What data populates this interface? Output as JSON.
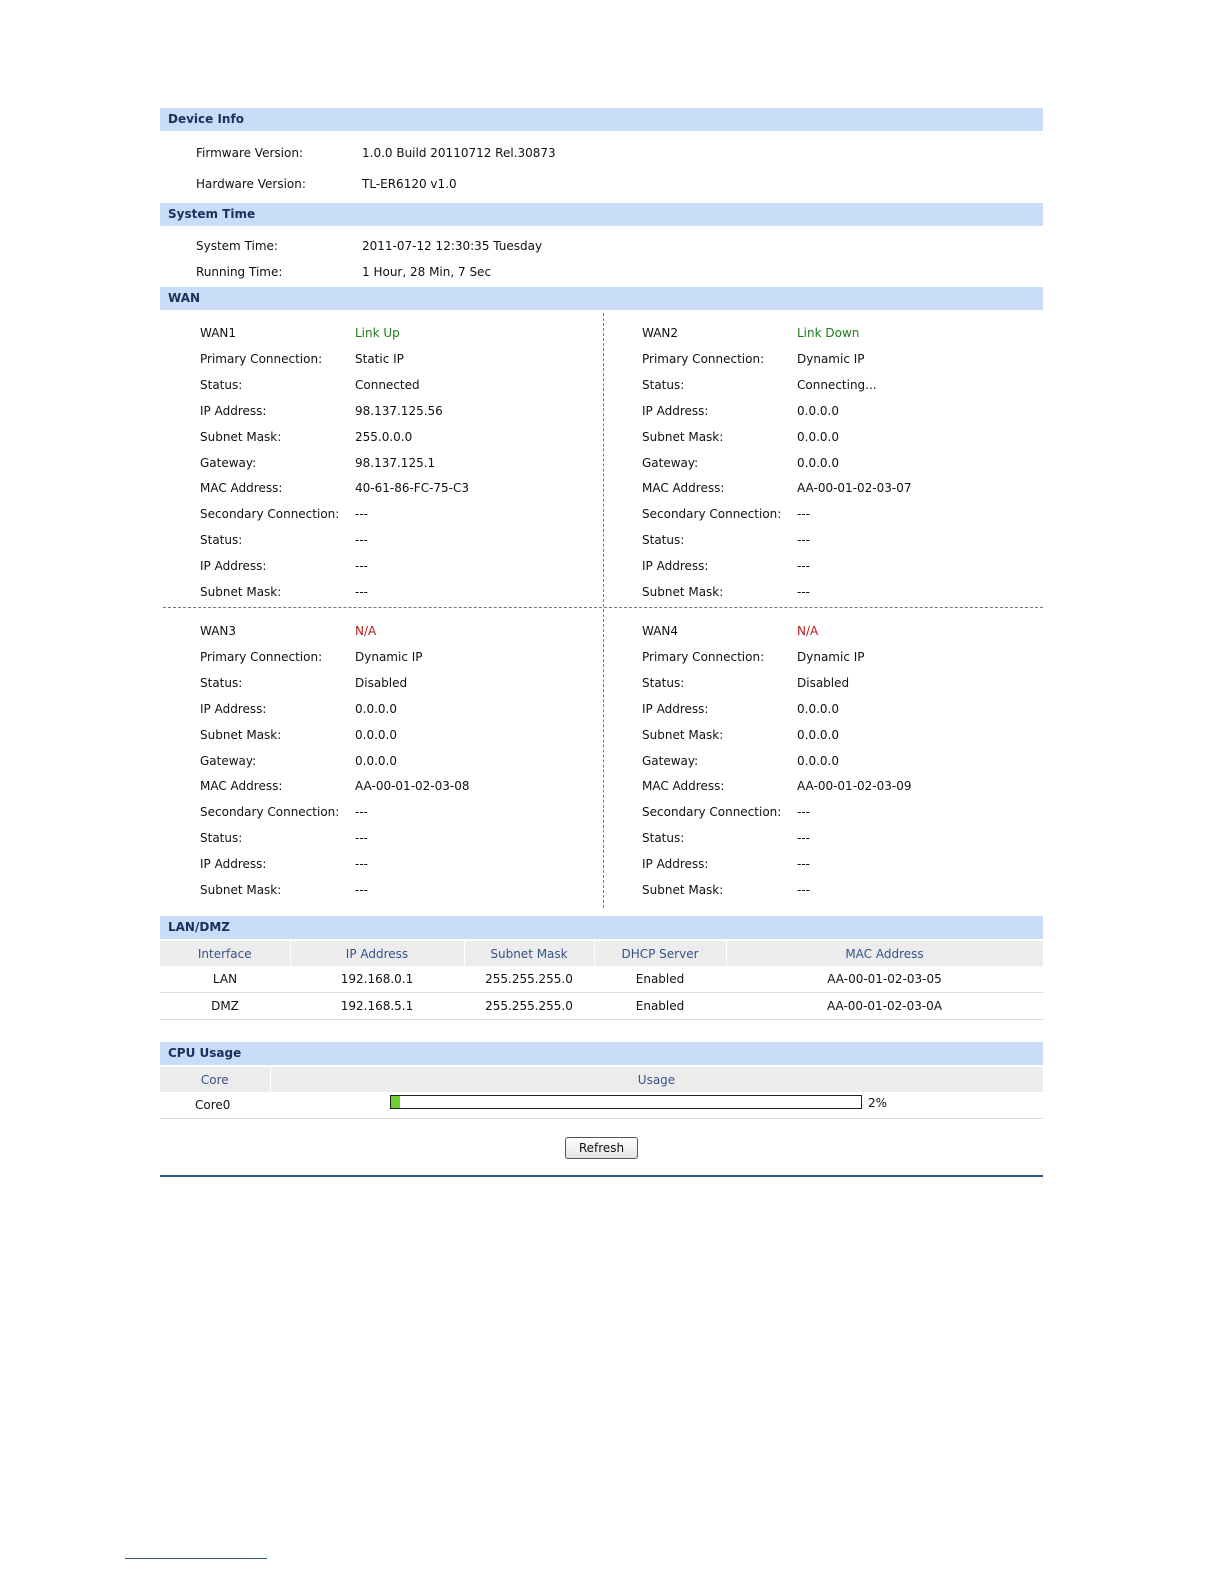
{
  "device_info": {
    "title": "Device Info",
    "firmware_label": "Firmware Version:",
    "firmware_value": "1.0.0 Build 20110712 Rel.30873",
    "hardware_label": "Hardware Version:",
    "hardware_value": "TL-ER6120 v1.0"
  },
  "system_time": {
    "title": "System Time",
    "system_time_label": "System Time:",
    "system_time_value": "2011-07-12 12:30:35 Tuesday",
    "running_time_label": "Running Time:",
    "running_time_value": "1 Hour, 28 Min, 7 Sec"
  },
  "wan": {
    "title": "WAN",
    "labels": {
      "primary": "Primary Connection:",
      "status": "Status:",
      "ip": "IP Address:",
      "mask": "Subnet Mask:",
      "gateway": "Gateway:",
      "mac": "MAC Address:",
      "secondary": "Secondary Connection:",
      "sec_status": "Status:",
      "sec_ip": "IP Address:",
      "sec_mask": "Subnet Mask:"
    },
    "ports": [
      {
        "name": "WAN1",
        "link": "Link Up",
        "link_color": "#1f7a1f",
        "primary": "Static IP",
        "status": "Connected",
        "ip": "98.137.125.56",
        "mask": "255.0.0.0",
        "gateway": "98.137.125.1",
        "mac": "40-61-86-FC-75-C3",
        "secondary": "---",
        "sec_status": "---",
        "sec_ip": "---",
        "sec_mask": "---"
      },
      {
        "name": "WAN2",
        "link": "Link Down",
        "link_color": "#1f7a1f",
        "primary": "Dynamic IP",
        "status": "Connecting...",
        "ip": "0.0.0.0",
        "mask": "0.0.0.0",
        "gateway": "0.0.0.0",
        "mac": "AA-00-01-02-03-07",
        "secondary": "---",
        "sec_status": "---",
        "sec_ip": "---",
        "sec_mask": "---"
      },
      {
        "name": "WAN3",
        "link": "N/A",
        "link_color": "#b51a1a",
        "primary": "Dynamic IP",
        "status": "Disabled",
        "ip": "0.0.0.0",
        "mask": "0.0.0.0",
        "gateway": "0.0.0.0",
        "mac": "AA-00-01-02-03-08",
        "secondary": "---",
        "sec_status": "---",
        "sec_ip": "---",
        "sec_mask": "---"
      },
      {
        "name": "WAN4",
        "link": "N/A",
        "link_color": "#b51a1a",
        "primary": "Dynamic IP",
        "status": "Disabled",
        "ip": "0.0.0.0",
        "mask": "0.0.0.0",
        "gateway": "0.0.0.0",
        "mac": "AA-00-01-02-03-09",
        "secondary": "---",
        "sec_status": "---",
        "sec_ip": "---",
        "sec_mask": "---"
      }
    ]
  },
  "lan_dmz": {
    "title": "LAN/DMZ",
    "headers": [
      "Interface",
      "IP Address",
      "Subnet Mask",
      "DHCP Server",
      "MAC Address"
    ],
    "rows": [
      [
        "LAN",
        "192.168.0.1",
        "255.255.255.0",
        "Enabled",
        "AA-00-01-02-03-05"
      ],
      [
        "DMZ",
        "192.168.5.1",
        "255.255.255.0",
        "Enabled",
        "AA-00-01-02-03-0A"
      ]
    ]
  },
  "cpu": {
    "title": "CPU Usage",
    "headers": [
      "Core",
      "Usage"
    ],
    "core": "Core0",
    "usage_text": "2%",
    "usage_fraction": 0.02,
    "bar_color": "#6cd12f"
  },
  "refresh_label": "Refresh"
}
